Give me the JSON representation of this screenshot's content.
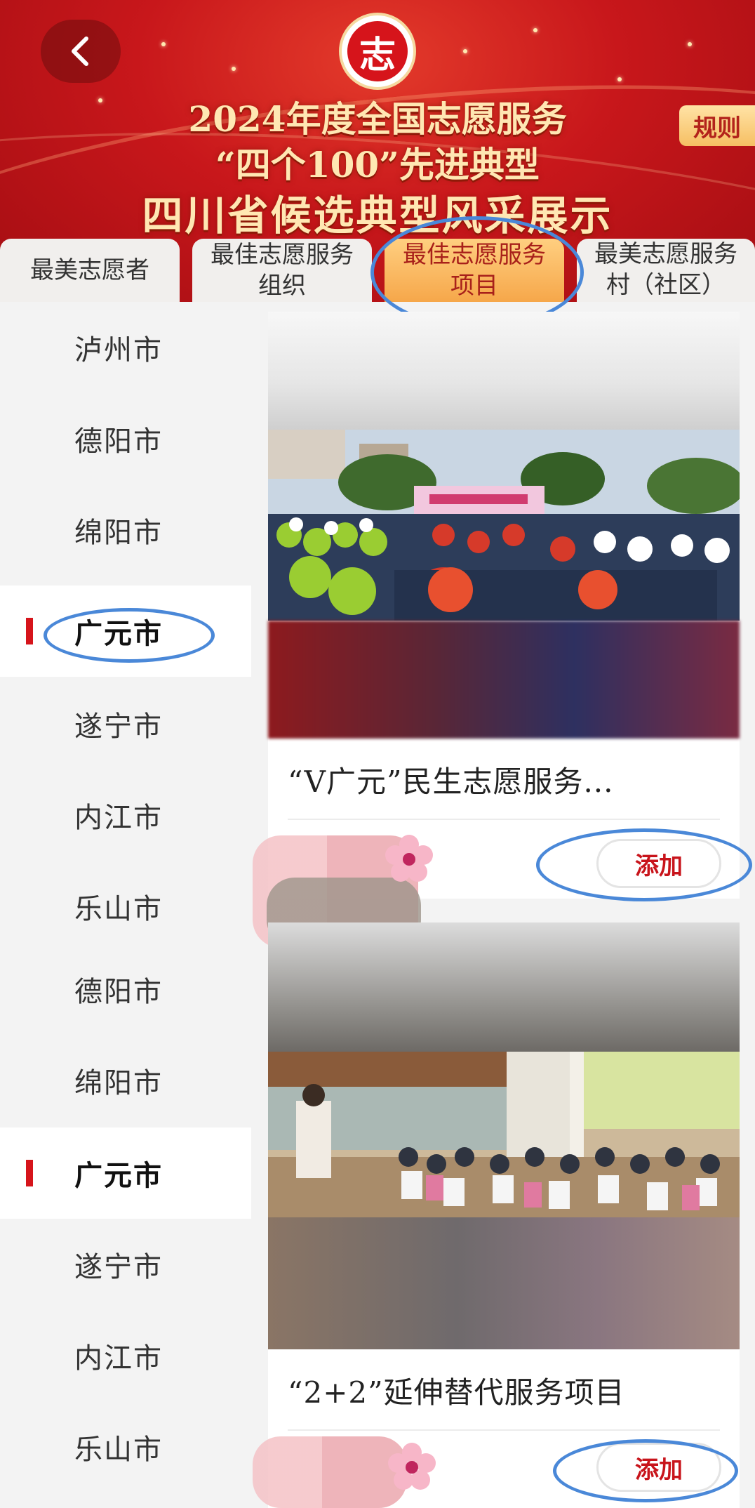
{
  "header": {
    "back_icon": "chevron-left-icon",
    "logo_char": "志",
    "title_line1": "2024年度全国志愿服务",
    "title_line2": "“四个100”先进典型",
    "title_line3": "四川省候选典型风采展示",
    "rules_label": "规则"
  },
  "tabs": [
    {
      "label": "最美志愿者"
    },
    {
      "label": "最佳志愿服务组织"
    },
    {
      "label": "最佳志愿服务项目",
      "active": true
    },
    {
      "label": "最美志愿服务村（社区）"
    }
  ],
  "sidebar": {
    "items": [
      {
        "label": "泸州市"
      },
      {
        "label": "德阳市"
      },
      {
        "label": "绵阳市"
      },
      {
        "label": "广元市",
        "active": true
      },
      {
        "label": "遂宁市"
      },
      {
        "label": "内江市"
      },
      {
        "label": "乐山市"
      },
      {
        "label": "德阳市"
      },
      {
        "label": "绵阳市"
      },
      {
        "label": "广元市",
        "active": true
      },
      {
        "label": "遂宁市"
      },
      {
        "label": "内江市"
      },
      {
        "label": "乐山市"
      }
    ]
  },
  "cards": [
    {
      "title": "“V广元”民生志愿服务...",
      "add_label": "添加",
      "photo_desc": "outdoor-ceremony-photo",
      "icon": "flower-icon"
    },
    {
      "title": "“2+2”延伸替代服务项目",
      "add_label": "添加",
      "photo_desc": "classroom-photo",
      "icon": "flower-icon"
    }
  ],
  "colors": {
    "brand_red": "#d6141b",
    "header_red": "#c8171b",
    "active_tab": "#f6a74a",
    "highlight_ring": "#4a88d8"
  }
}
